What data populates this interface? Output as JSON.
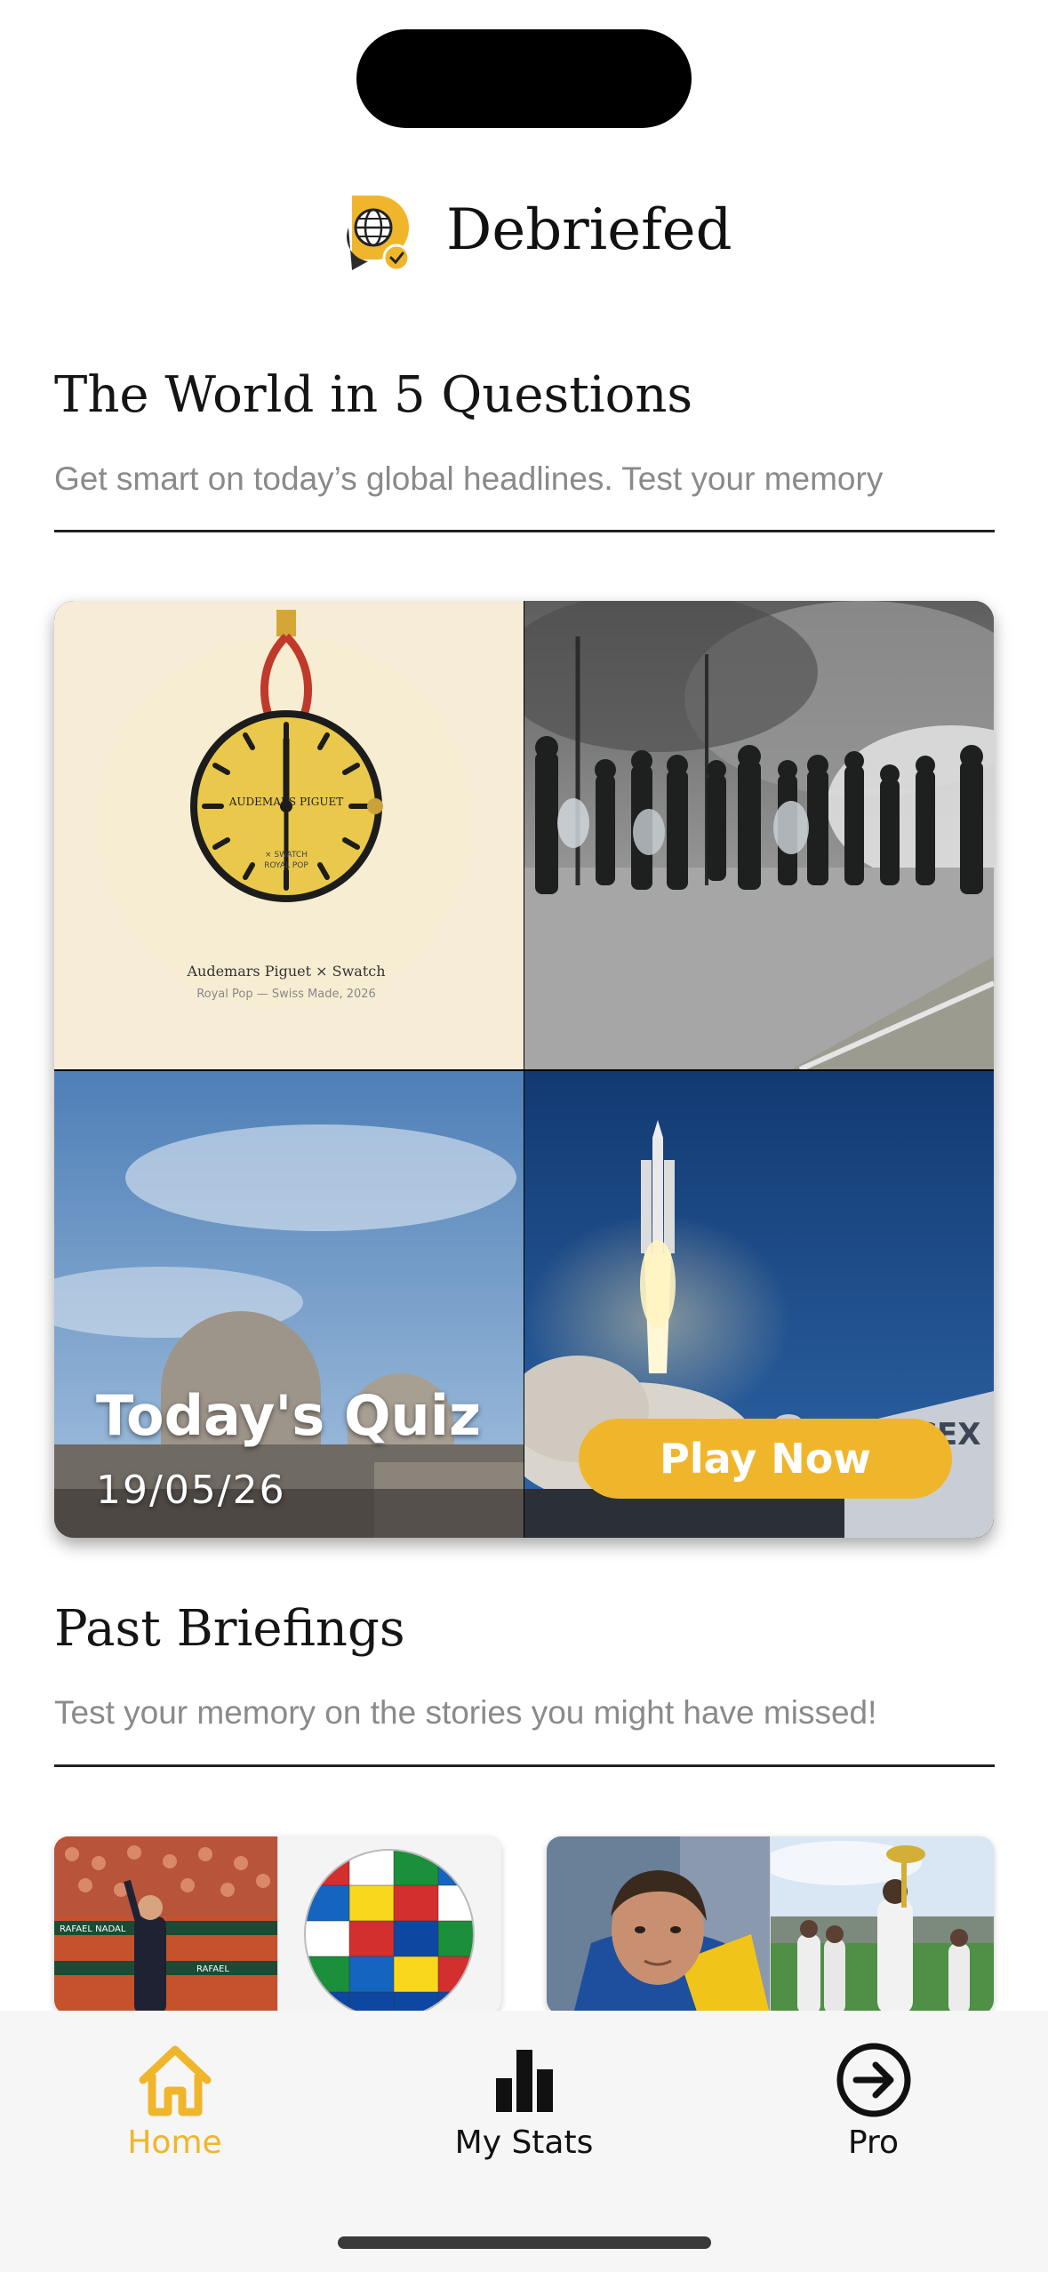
{
  "app": {
    "name": "Debriefed"
  },
  "todays_section": {
    "title": "The World in 5 Questions",
    "subtitle": "Get smart on today’s global headlines. Test your memory"
  },
  "quiz_card": {
    "title": "Today's Quiz",
    "date": "19/05/26",
    "play_label": "Play Now",
    "watch_caption": "Audemars Piguet × Swatch",
    "watch_subcaption": "Royal Pop — Swiss Made, 2026",
    "watch_dial_brand": "AUDEMARS PIGUET",
    "watch_dial_line1": "× SWATCH",
    "watch_dial_line2": "ROYAL POP",
    "rocket_building_text": "SPACEX"
  },
  "past_section": {
    "title": "Past Briefings",
    "subtitle": "Test your memory on the stories you might have missed!"
  },
  "past_cards": [
    {
      "banner_text_1": "RAFAEL NADAL",
      "banner_text_2": "RAFAEL"
    },
    {}
  ],
  "tabs": [
    {
      "label": "Home",
      "icon": "home-icon",
      "active": true
    },
    {
      "label": "My Stats",
      "icon": "bar-chart-icon",
      "active": false
    },
    {
      "label": "Pro",
      "icon": "arrow-circle-icon",
      "active": false
    }
  ],
  "colors": {
    "accent": "#f0b62b",
    "text": "#111111",
    "muted": "#8a8a8a"
  }
}
